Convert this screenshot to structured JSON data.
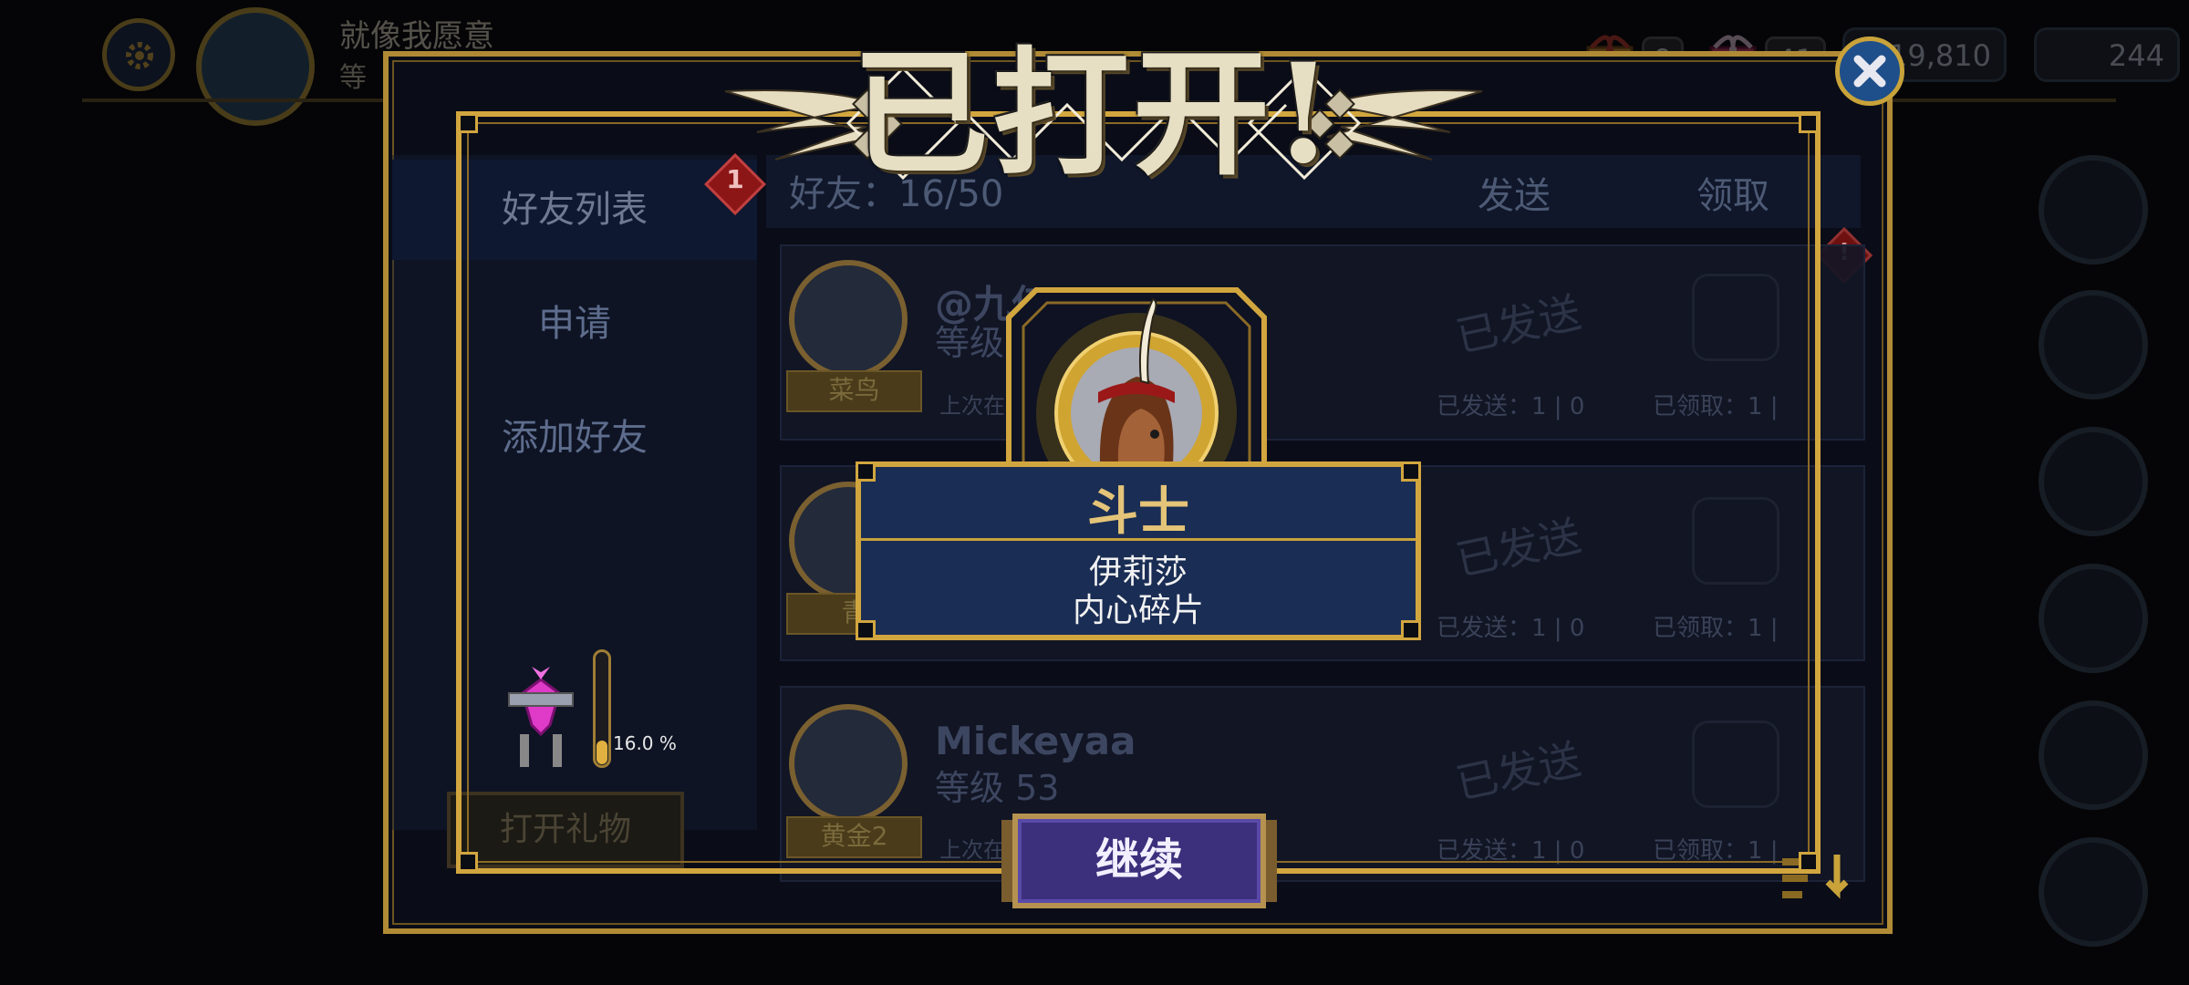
{
  "player": {
    "name": "就像我愿意",
    "level_label": "等"
  },
  "currency": {
    "gift_yellow": "9",
    "gift_pink": "41",
    "coins": "19,810",
    "gems": "244"
  },
  "popup": {
    "title": "已打开!",
    "continue_label": "继续"
  },
  "reward": {
    "title": "斗士",
    "line1": "伊莉莎",
    "line2": "内心碎片"
  },
  "friends_panel": {
    "menu": [
      {
        "label": "好友列表",
        "active": true,
        "badge": "1"
      },
      {
        "label": "申请"
      },
      {
        "label": "添加好友"
      }
    ],
    "header": {
      "friends": "好友：16/50",
      "send": "发送",
      "receive": "领取"
    },
    "notification_badge": "!",
    "rows": [
      {
        "name": "@九亿",
        "level": "等级",
        "rank": "菜鸟",
        "last": "上次在",
        "stamp": "已发送",
        "sent": "已发送：1 | 0",
        "received": "已领取：1 |"
      },
      {
        "name": "",
        "level": "",
        "rank": "青",
        "last": "",
        "stamp": "已发送",
        "sent": "已发送：1 | 0",
        "received": "已领取：1 |"
      },
      {
        "name": "Mickeyaa",
        "level": "等级 53",
        "rank": "黄金2",
        "last": "上次在",
        "stamp": "已发送",
        "sent": "已发送：1 | 0",
        "received": "已领取：1 |"
      }
    ],
    "side_badge": "1",
    "progress": {
      "percent_label": "16.0 %",
      "value": 0.16
    },
    "open_gift_label": "打开礼物"
  },
  "colors": {
    "gold": "#d2a63f",
    "panel_blue": "#1a2d54",
    "button_purple": "#3c2f7c"
  }
}
